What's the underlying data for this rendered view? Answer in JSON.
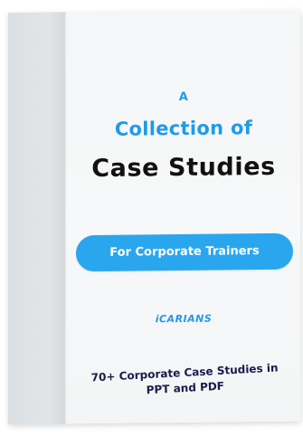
{
  "cover": {
    "pre_title": "A",
    "title_line_1": "Collection of",
    "title_line_2": "Case Studies",
    "audience_button": "For Corporate Trainers",
    "brand": "iCARIANS",
    "tagline": "70+ Corporate Case Studies in PPT and PDF"
  },
  "colors": {
    "accent": "#1e9be8",
    "button": "#2aa6ee",
    "title": "#111111",
    "tagline": "#1a1a4a",
    "spine": "#dcdfe1",
    "cover": "#f4f6f7"
  }
}
